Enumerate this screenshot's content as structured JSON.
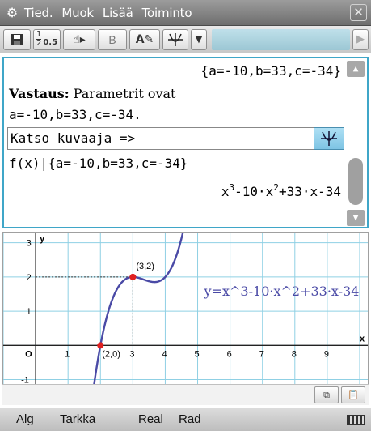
{
  "menubar": {
    "icon": "gear-icon",
    "items": [
      "Tied.",
      "Muok",
      "Lisää",
      "Toiminto"
    ],
    "close_icon": "close-icon"
  },
  "toolbar": {
    "icons": [
      "save-icon",
      "fraction-decimal-icon",
      "hand-pointer-icon",
      "bold-icon",
      "text-edit-icon",
      "graph-icon",
      "dropdown-icon"
    ],
    "bold_label": "B",
    "fraction_top": "1",
    "fraction_bottom": "2",
    "decimal_label": "0.5"
  },
  "main": {
    "line1": "{a=-10,b=33,c=-34}",
    "answer_label": "Vastaus:",
    "answer_text": " Parametrit ovat",
    "line3": "a=-10,b=33,c=-34.",
    "graph_text": "Katso kuvaaja =>",
    "line5": "f(x)|{a=-10,b=33,c=-34}",
    "result_parts": [
      "x",
      "3",
      "-10·x",
      "2",
      "+33·x-34"
    ]
  },
  "graph": {
    "equation_label": "y=x^3-10·x^2+33·x-34",
    "point_label_1": "(3,2)",
    "point_label_2": "(2,0)",
    "x_axis_label": "x",
    "y_axis_label": "y",
    "x_ticks": [
      "1",
      "3",
      "4",
      "5",
      "6",
      "7",
      "8",
      "9"
    ],
    "y_ticks": [
      "3",
      "2",
      "1",
      "-1"
    ],
    "origin_label": "O",
    "points": [
      {
        "x": 3,
        "y": 2
      },
      {
        "x": 2,
        "y": 0
      }
    ],
    "curve_color": "#4a4aa6",
    "point_color": "#e02020"
  },
  "chart_data": {
    "type": "line",
    "title": "",
    "xlabel": "x",
    "ylabel": "y",
    "xlim": [
      -1,
      10.3
    ],
    "ylim": [
      -1.2,
      3.3
    ],
    "series": [
      {
        "name": "y=x^3-10·x^2+33·x-34",
        "function": "x^3-10*x^2+33*x-34"
      }
    ],
    "annotations": [
      {
        "x": 3,
        "y": 2,
        "label": "(3,2)"
      },
      {
        "x": 2,
        "y": 0,
        "label": "(2,0)"
      }
    ],
    "grid": true
  },
  "statusbar": {
    "items": [
      "Alg",
      "Tarkka",
      "Real",
      "Rad"
    ],
    "battery_icon": "battery-icon"
  }
}
